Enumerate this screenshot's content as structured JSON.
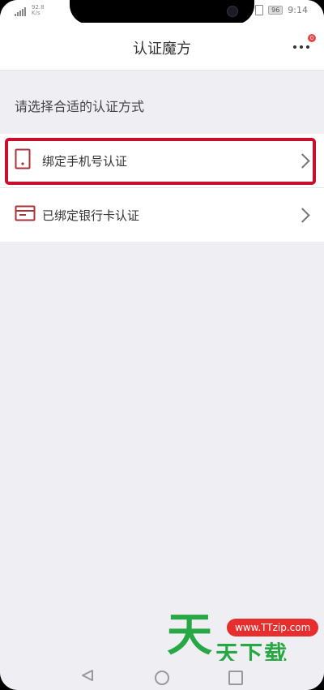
{
  "status_bar": {
    "speed": "92.8\nK/s",
    "battery": "96",
    "time": "9:14"
  },
  "header": {
    "title": "认证魔方",
    "more_badge_count": "0"
  },
  "content": {
    "section_title": "请选择合适的认证方式",
    "items": [
      {
        "icon": "phone-icon",
        "label": "绑定手机号认证",
        "highlighted": true
      },
      {
        "icon": "bank-card-icon",
        "label": "已绑定银行卡认证",
        "highlighted": false
      }
    ]
  },
  "watermark": {
    "url": "www.TTzip.com",
    "big_char": "天",
    "text": "天下载"
  },
  "colors": {
    "highlight": "#c8102e",
    "icon_accent": "#a8323a",
    "watermark_green": "#27a844",
    "watermark_red": "#e62e2e"
  }
}
